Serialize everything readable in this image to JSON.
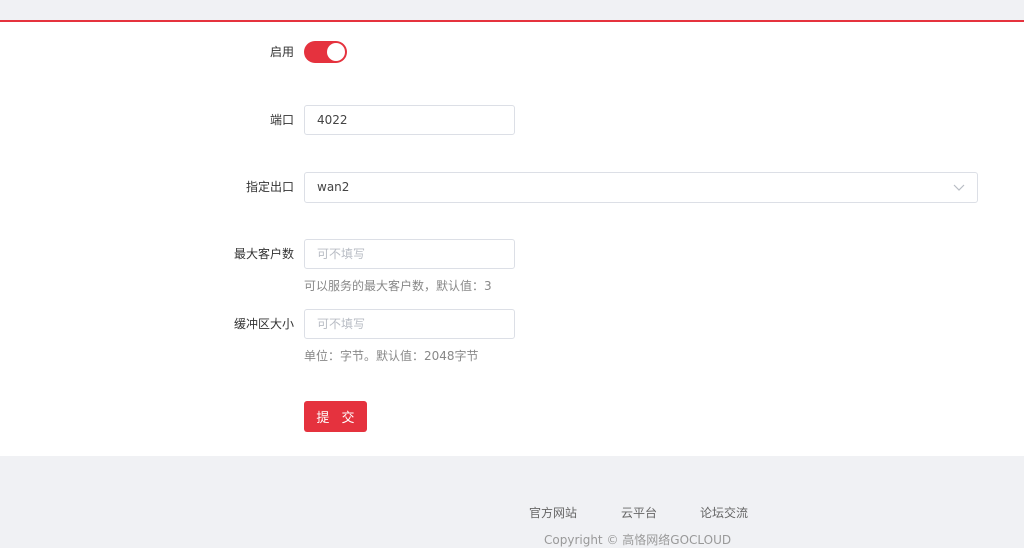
{
  "form": {
    "enable": {
      "label": "启用",
      "on": true
    },
    "port": {
      "label": "端口",
      "value": "4022"
    },
    "outlet": {
      "label": "指定出口",
      "value": "wan2",
      "icon": "chevron-down-icon"
    },
    "max_clients": {
      "label": "最大客户数",
      "placeholder": "可不填写",
      "hint": "可以服务的最大客户数，默认值：3"
    },
    "buffer_size": {
      "label": "缓冲区大小",
      "placeholder": "可不填写",
      "hint": "单位：字节。默认值：2048字节"
    },
    "submit_label": "提 交"
  },
  "footer": {
    "links": [
      "官方网站",
      "云平台",
      "论坛交流"
    ],
    "copyright": "Copyright © 高恪网络GOCLOUD"
  },
  "colors": {
    "accent": "#e5323e",
    "border": "#dcdfe6",
    "background": "#f0f1f4"
  }
}
